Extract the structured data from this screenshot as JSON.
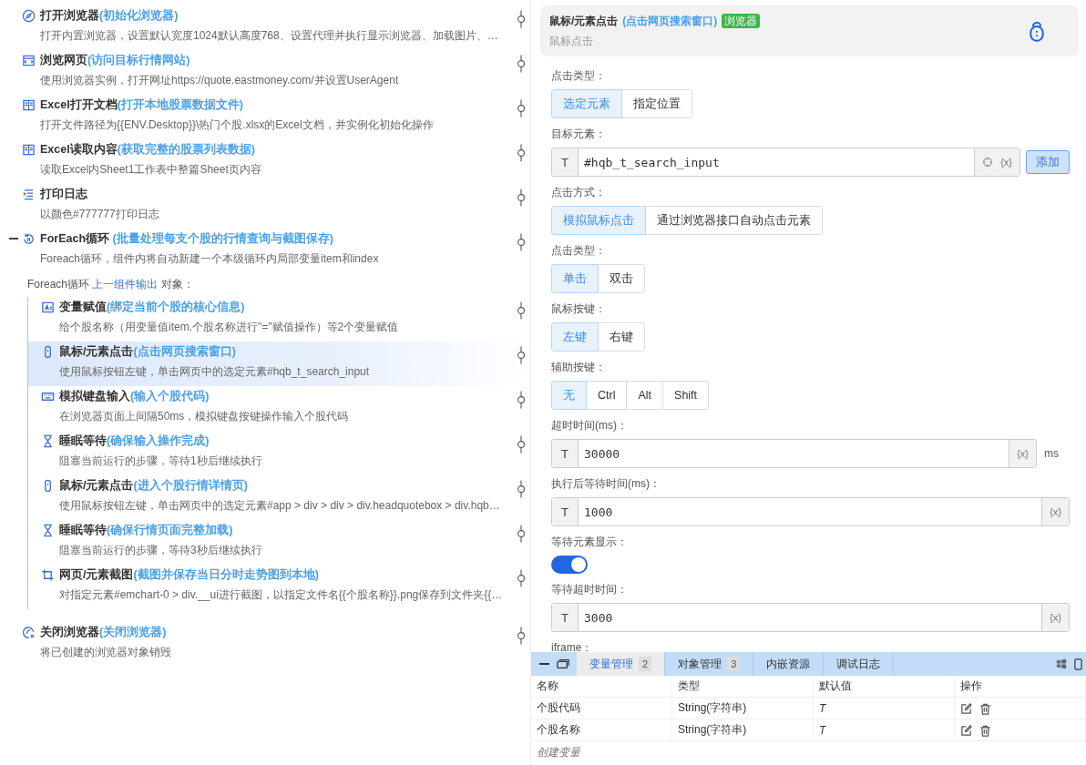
{
  "flow": {
    "steps": [
      {
        "kind": "compass",
        "title": "打开浏览器",
        "note": "(初始化浏览器)",
        "desc": "打开内置浏览器，设置默认宽度1024默认高度768、设置代理并执行显示浏览器、加载图片、…",
        "selected": false
      },
      {
        "kind": "window",
        "title": "浏览网页",
        "note": "(访问目标行情网站)",
        "desc": "使用浏览器实例，打开网址https://quote.eastmoney.com/并设置UserAgent",
        "selected": false
      },
      {
        "kind": "book",
        "title": "Excel打开文档",
        "note": "(打开本地股票数据文件)",
        "desc": "打开文件路径为{{ENV.Desktop}}\\热门个股.xlsx的Excel文档，并实例化初始化操作",
        "selected": false
      },
      {
        "kind": "book",
        "title": "Excel读取内容",
        "note": "(获取完整的股票列表数据)",
        "desc": "读取Excel内Sheet1工作表中整篇Sheet页内容",
        "selected": false
      },
      {
        "kind": "list",
        "title": "打印日志",
        "desc": "以颜色#777777打印日志",
        "selected": false
      },
      {
        "kind": "loop",
        "title": "ForEach循环",
        "note": " (批量处理每支个股的行情查询与截图保存)",
        "desc": "Foreach循环，组件内将自动新建一个本级循环内局部变量item和index",
        "selected": false,
        "expanded": true,
        "loop_label": {
          "prefix": "Foreach循环",
          "link": "上一组件输出",
          "suffix": "对象："
        },
        "children": [
          {
            "kind": "assign",
            "title": "变量赋值",
            "note": "(绑定当前个股的核心信息)",
            "desc": "给个股名称（用变量值item.个股名称进行\"=\"赋值操作）等2个变量赋值",
            "selected": false
          },
          {
            "kind": "mouse",
            "title": "鼠标/元素点击",
            "note": "(点击网页搜索窗口)",
            "desc": "使用鼠标按钮左键，单击网页中的选定元素#hqb_t_search_input",
            "selected": true
          },
          {
            "kind": "keyboard",
            "title": "模拟键盘输入",
            "note": "(输入个股代码)",
            "desc": "在浏览器页面上间隔50ms，模拟键盘按键操作输入个股代码",
            "selected": false
          },
          {
            "kind": "hourglass",
            "title": "睡眠等待",
            "note": "(确保输入操作完成)",
            "desc": "阻塞当前运行的步骤，等待1秒后继续执行",
            "selected": false
          },
          {
            "kind": "mouse",
            "title": "鼠标/元素点击",
            "note": "(进入个股行情详情页)",
            "desc": "使用鼠标按钮左键，单击网页中的选定元素#app > div > div > div.headquotebox > div.hqb…",
            "selected": false
          },
          {
            "kind": "hourglass",
            "title": "睡眠等待",
            "note": "(确保行情页面完整加载)",
            "desc": "阻塞当前运行的步骤，等待3秒后继续执行",
            "selected": false
          },
          {
            "kind": "crop",
            "title": "网页/元素截图",
            "note": "(截图并保存当日分时走势图到本地)",
            "desc": "对指定元素#emchart-0 > div.__ui进行截图，以指定文件名{{个股名称}}.png保存到文件夹{{…",
            "selected": false
          }
        ]
      },
      {
        "kind": "close-browser",
        "title": "关闭浏览器",
        "note": "(关闭浏览器)",
        "desc": "将已创建的浏览器对象销毁",
        "selected": false
      }
    ]
  },
  "inspector": {
    "title": "鼠标/元素点击",
    "note": "(点击网页搜索窗口)",
    "tag": "浏览器",
    "subtitle": "鼠标点击",
    "fields": [
      {
        "kind": "segmented",
        "label": "点击类型：",
        "options": [
          {
            "label": "选定元素",
            "selected": true
          },
          {
            "label": "指定位置",
            "selected": false
          }
        ]
      },
      {
        "kind": "input",
        "label": "目标元素：",
        "prefix": "T",
        "value": "#hqb_t_search_input",
        "picker": true,
        "var": "{x}",
        "button": "添加"
      },
      {
        "kind": "segmented",
        "label": "点击方式：",
        "options": [
          {
            "label": "模拟鼠标点击",
            "selected": true
          },
          {
            "label": "通过浏览器接口自动点击元素",
            "selected": false
          }
        ]
      },
      {
        "kind": "segmented",
        "label": "点击类型：",
        "options": [
          {
            "label": "单击",
            "selected": true
          },
          {
            "label": "双击",
            "selected": false
          }
        ]
      },
      {
        "kind": "segmented",
        "label": "鼠标按键：",
        "options": [
          {
            "label": "左键",
            "selected": true
          },
          {
            "label": "右键",
            "selected": false
          }
        ]
      },
      {
        "kind": "segmented",
        "label": "辅助按键：",
        "options": [
          {
            "label": "无",
            "selected": true
          },
          {
            "label": "Ctrl",
            "selected": false
          },
          {
            "label": "Alt",
            "selected": false
          },
          {
            "label": "Shift",
            "selected": false
          }
        ]
      },
      {
        "kind": "input",
        "label": "超时时间(ms)：",
        "prefix": "T",
        "value": "30000",
        "var": "{x}",
        "unit": "ms"
      },
      {
        "kind": "input",
        "label": "执行后等待时间(ms)：",
        "prefix": "T",
        "value": "1000",
        "var": "{x}"
      },
      {
        "kind": "switch",
        "label": "等待元素显示：",
        "on": true
      },
      {
        "kind": "input",
        "label": "等待超时时间：",
        "prefix": "T",
        "value": "3000",
        "var": "{x}"
      },
      {
        "kind": "label",
        "label": "iframe："
      }
    ]
  },
  "bottom_panel": {
    "tabs": [
      {
        "label": "变量管理",
        "count": "2",
        "selected": true
      },
      {
        "label": "对象管理",
        "count": "3",
        "selected": false
      },
      {
        "label": "内嵌资源",
        "selected": false
      },
      {
        "label": "调试日志",
        "selected": false
      }
    ],
    "table": {
      "columns": [
        "名称",
        "类型",
        "默认值",
        "操作"
      ],
      "rows": [
        {
          "name": "个股代码",
          "type": "String(字符串)",
          "default": "T"
        },
        {
          "name": "个股名称",
          "type": "String(字符串)",
          "default": "T"
        }
      ]
    },
    "create_link": "创建变量"
  }
}
